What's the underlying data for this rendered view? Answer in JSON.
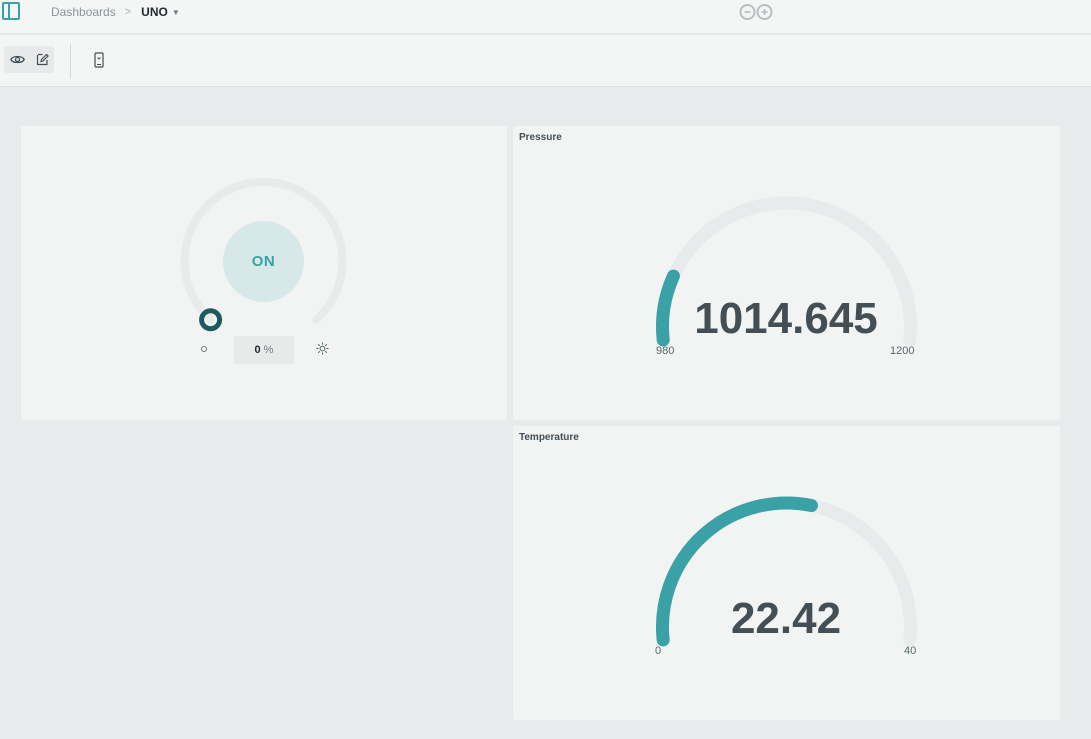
{
  "breadcrumb": {
    "root": "Dashboards",
    "separator": ">",
    "current": "UNO"
  },
  "colors": {
    "accent": "#3aa1a6",
    "track": "#e8ebeb",
    "dark_handle": "#1e5a5d"
  },
  "icons": {
    "sidebar": "sidebar-toggle-icon",
    "logo": "arduino-logo-icon",
    "view": "eye-icon",
    "edit": "pencil-icon",
    "mobile": "mobile-phone-icon",
    "sun": "sun-icon"
  },
  "switch_widget": {
    "button_label": "ON",
    "dimmer_value": "0",
    "dimmer_unit": "%",
    "dimmer_level": 0
  },
  "pressure": {
    "title": "Pressure",
    "value": "1014.645",
    "min": "980",
    "max": "1200",
    "value_num": 1014.645,
    "min_num": 980,
    "max_num": 1200
  },
  "temperature": {
    "title": "Temperature",
    "value": "22.42",
    "min": "0",
    "max": "40",
    "value_num": 22.42,
    "min_num": 0,
    "max_num": 40
  }
}
